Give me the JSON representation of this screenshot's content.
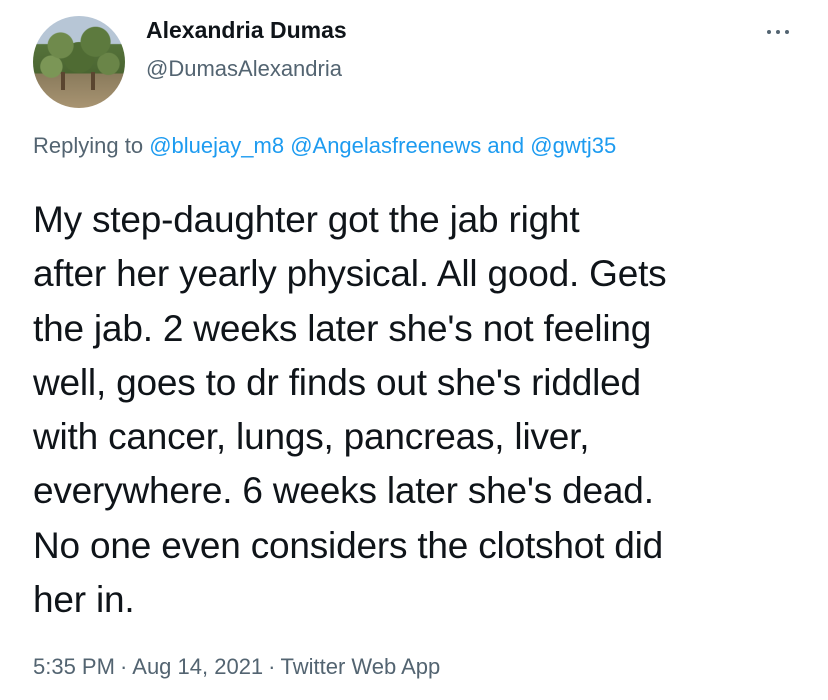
{
  "tweet": {
    "author": {
      "name": "Alexandria Dumas",
      "handle": "@DumasAlexandria"
    },
    "reply": {
      "prefix": "Replying to",
      "mentions": [
        "@bluejay_m8",
        "@Angelasfreenews"
      ],
      "conjunction": "and",
      "last_mention": "@gwtj35"
    },
    "body_lines": [
      "My step-daughter got the jab right",
      "after her yearly physical. All good. Gets",
      "the jab. 2 weeks later she's not feeling",
      "well, goes to dr finds out she's riddled",
      "with cancer, lungs, pancreas, liver,",
      "everywhere. 6 weeks later she's dead.",
      "No one even considers the clotshot did",
      "her in."
    ],
    "meta": {
      "time": "5:35 PM",
      "date": "Aug 14, 2021",
      "source": "Twitter Web App",
      "separator": "·"
    },
    "more_icon": "more-horizontal-icon",
    "colors": {
      "text": "#0f1419",
      "secondary": "#536471",
      "link": "#1d9bf0"
    }
  }
}
